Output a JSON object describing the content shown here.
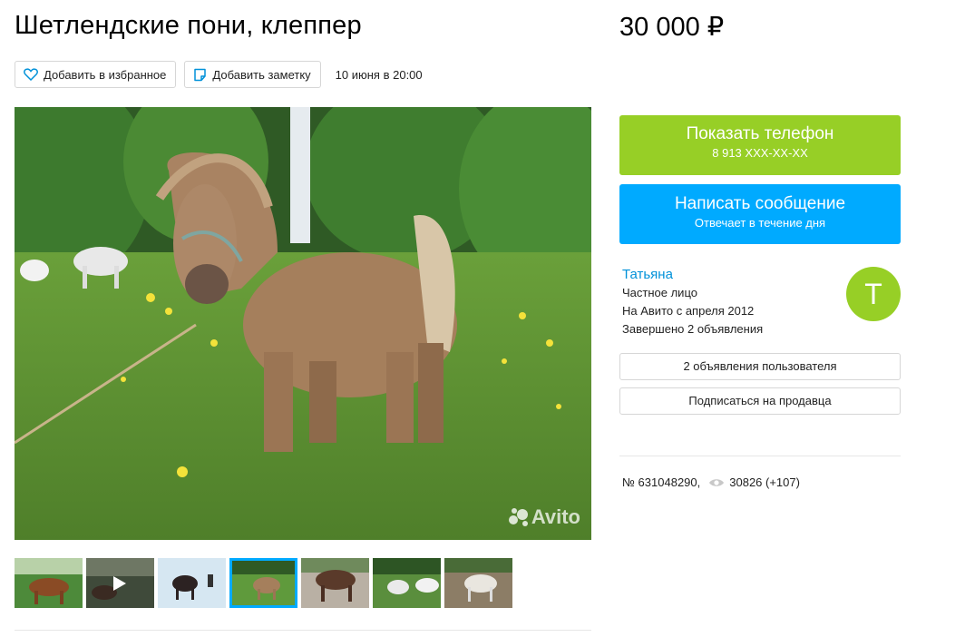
{
  "listing": {
    "title": "Шетлендские пони, клеппер",
    "price": "30 000 ₽",
    "date": "10 июня в 20:00",
    "favorite_label": "Добавить в избранное",
    "note_label": "Добавить заметку",
    "watermark": "Avito"
  },
  "contact": {
    "phone_title": "Показать телефон",
    "phone_number": "8 913 XXX-XX-XX",
    "message_title": "Написать сообщение",
    "message_sub": "Отвечает в течение дня"
  },
  "seller": {
    "name": "Татьяна",
    "type": "Частное лицо",
    "since": "На Авито с апреля 2012",
    "completed": "Завершено 2 объявления",
    "avatar_letter": "Т",
    "listings_button": "2 объявления пользователя",
    "subscribe_button": "Подписаться на продавца"
  },
  "meta": {
    "number": "№ 631048290,",
    "views": "30826 (+107)"
  },
  "colors": {
    "green": "#97cf26",
    "blue": "#00aaff",
    "link": "#0091d9",
    "thumb_active": "#00aaff"
  },
  "icons": {
    "favorite": "heart-icon",
    "note": "note-icon",
    "views": "eye-icon",
    "video": "play-icon"
  }
}
